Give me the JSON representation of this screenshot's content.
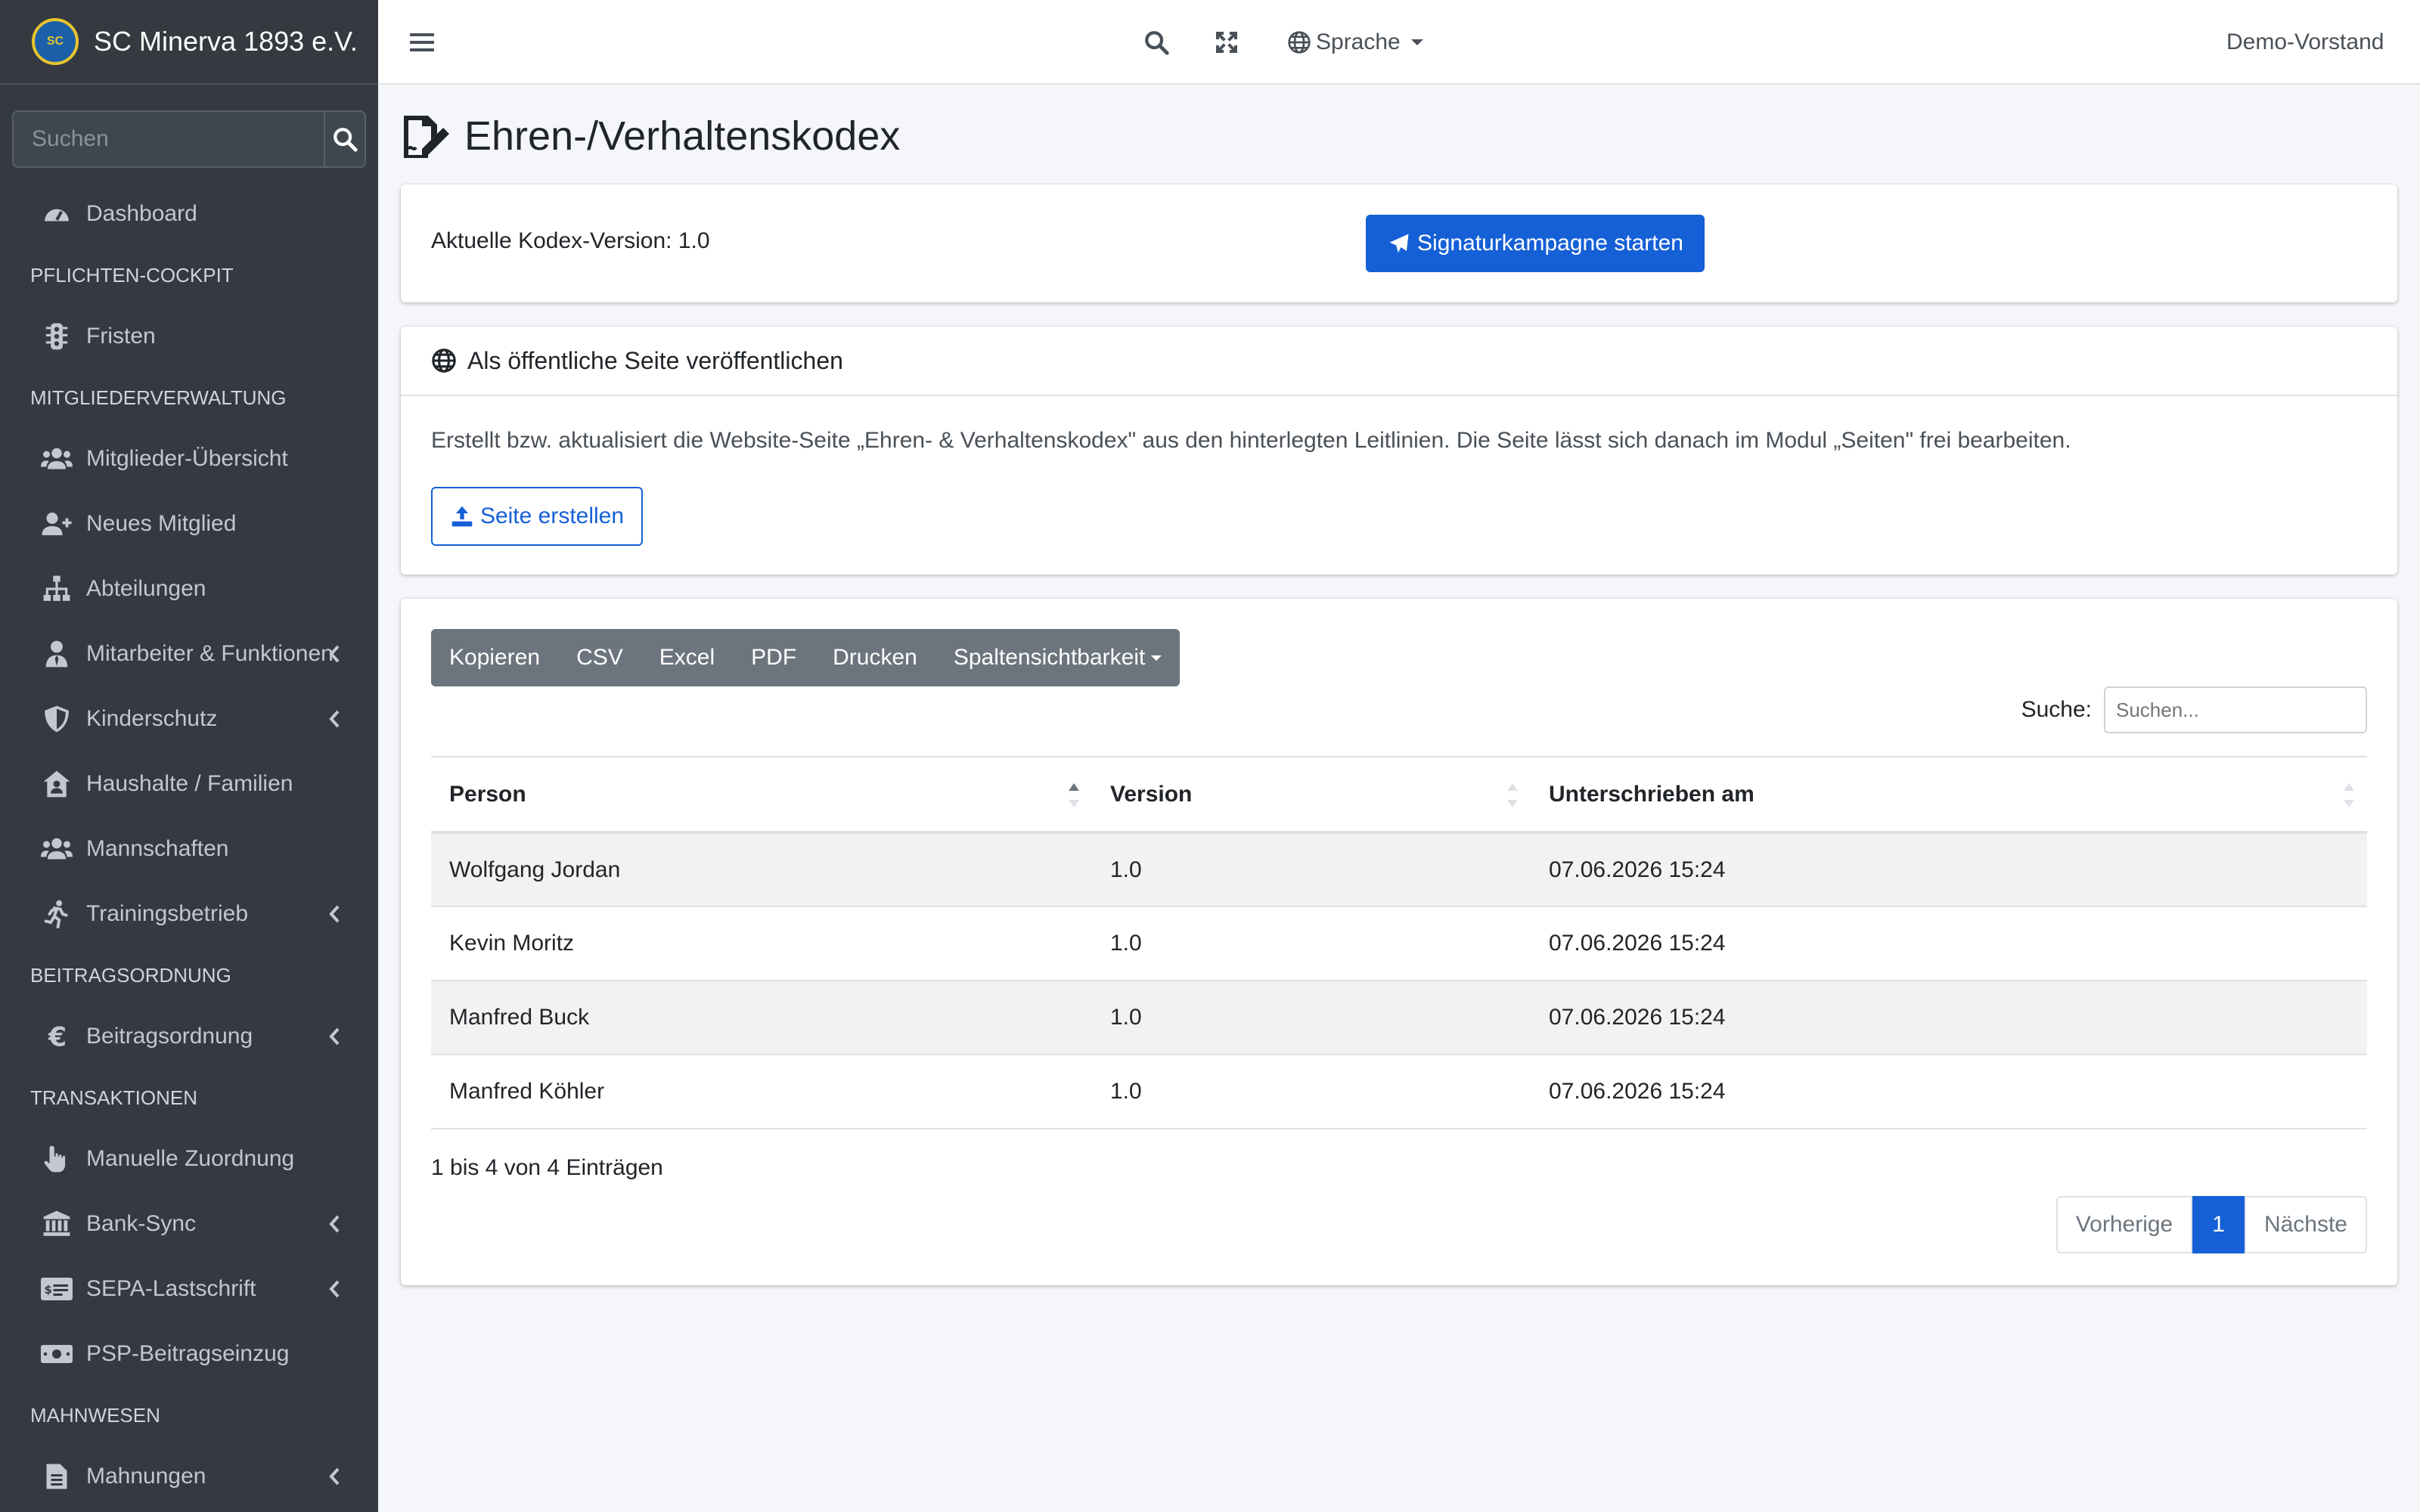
{
  "brand": {
    "name": "SC Minerva 1893 e.V.",
    "logo_text": "SC"
  },
  "sidebar": {
    "search_placeholder": "Suchen",
    "items": [
      {
        "type": "item",
        "label": "Dashboard",
        "icon": "tachometer-icon"
      },
      {
        "type": "header",
        "label": "PFLICHTEN-COCKPIT"
      },
      {
        "type": "item",
        "label": "Fristen",
        "icon": "traffic-light-icon"
      },
      {
        "type": "header",
        "label": "MITGLIEDERVERWALTUNG"
      },
      {
        "type": "item",
        "label": "Mitglieder-Übersicht",
        "icon": "users-icon"
      },
      {
        "type": "item",
        "label": "Neues Mitglied",
        "icon": "user-plus-icon"
      },
      {
        "type": "item",
        "label": "Abteilungen",
        "icon": "sitemap-icon"
      },
      {
        "type": "item",
        "label": "Mitarbeiter & Funktionen",
        "icon": "user-tie-icon",
        "expandable": true
      },
      {
        "type": "item",
        "label": "Kinderschutz",
        "icon": "shield-icon",
        "expandable": true
      },
      {
        "type": "item",
        "label": "Haushalte / Familien",
        "icon": "house-user-icon"
      },
      {
        "type": "item",
        "label": "Mannschaften",
        "icon": "users-icon"
      },
      {
        "type": "item",
        "label": "Trainingsbetrieb",
        "icon": "running-icon",
        "expandable": true
      },
      {
        "type": "header",
        "label": "BEITRAGSORDNUNG"
      },
      {
        "type": "item",
        "label": "Beitragsordnung",
        "icon": "euro-icon",
        "expandable": true
      },
      {
        "type": "header",
        "label": "TRANSAKTIONEN"
      },
      {
        "type": "item",
        "label": "Manuelle Zuordnung",
        "icon": "hand-pointer-icon"
      },
      {
        "type": "item",
        "label": "Bank-Sync",
        "icon": "bank-icon",
        "expandable": true
      },
      {
        "type": "item",
        "label": "SEPA-Lastschrift",
        "icon": "money-check-icon",
        "expandable": true
      },
      {
        "type": "item",
        "label": "PSP-Beitragseinzug",
        "icon": "money-bill-icon"
      },
      {
        "type": "header",
        "label": "MAHNWESEN"
      },
      {
        "type": "item",
        "label": "Mahnungen",
        "icon": "file-icon",
        "expandable": true
      }
    ]
  },
  "topbar": {
    "language_label": "Sprache",
    "user_label": "Demo-Vorstand"
  },
  "page": {
    "title": "Ehren-/Verhaltenskodex"
  },
  "version_card": {
    "text": "Aktuelle Kodex-Version: 1.0",
    "button_label": "Signaturkampagne starten"
  },
  "publish_card": {
    "title": "Als öffentliche Seite veröffentlichen",
    "description": "Erstellt bzw. aktualisiert die Website-Seite „Ehren- & Verhaltenskodex\" aus den hinterlegten Leitlinien. Die Seite lässt sich danach im Modul „Seiten\" frei bearbeiten.",
    "button_label": "Seite erstellen"
  },
  "table_card": {
    "buttons": [
      "Kopieren",
      "CSV",
      "Excel",
      "PDF",
      "Drucken",
      "Spaltensichtbarkeit"
    ],
    "search_label": "Suche:",
    "search_placeholder": "Suchen...",
    "columns": [
      "Person",
      "Version",
      "Unterschrieben am"
    ],
    "rows": [
      [
        "Wolfgang Jordan",
        "1.0",
        "07.06.2026 15:24"
      ],
      [
        "Kevin Moritz",
        "1.0",
        "07.06.2026 15:24"
      ],
      [
        "Manfred Buck",
        "1.0",
        "07.06.2026 15:24"
      ],
      [
        "Manfred Köhler",
        "1.0",
        "07.06.2026 15:24"
      ]
    ],
    "info": "1 bis 4 von 4 Einträgen",
    "pager": {
      "prev": "Vorherige",
      "current": "1",
      "next": "Nächste"
    }
  }
}
